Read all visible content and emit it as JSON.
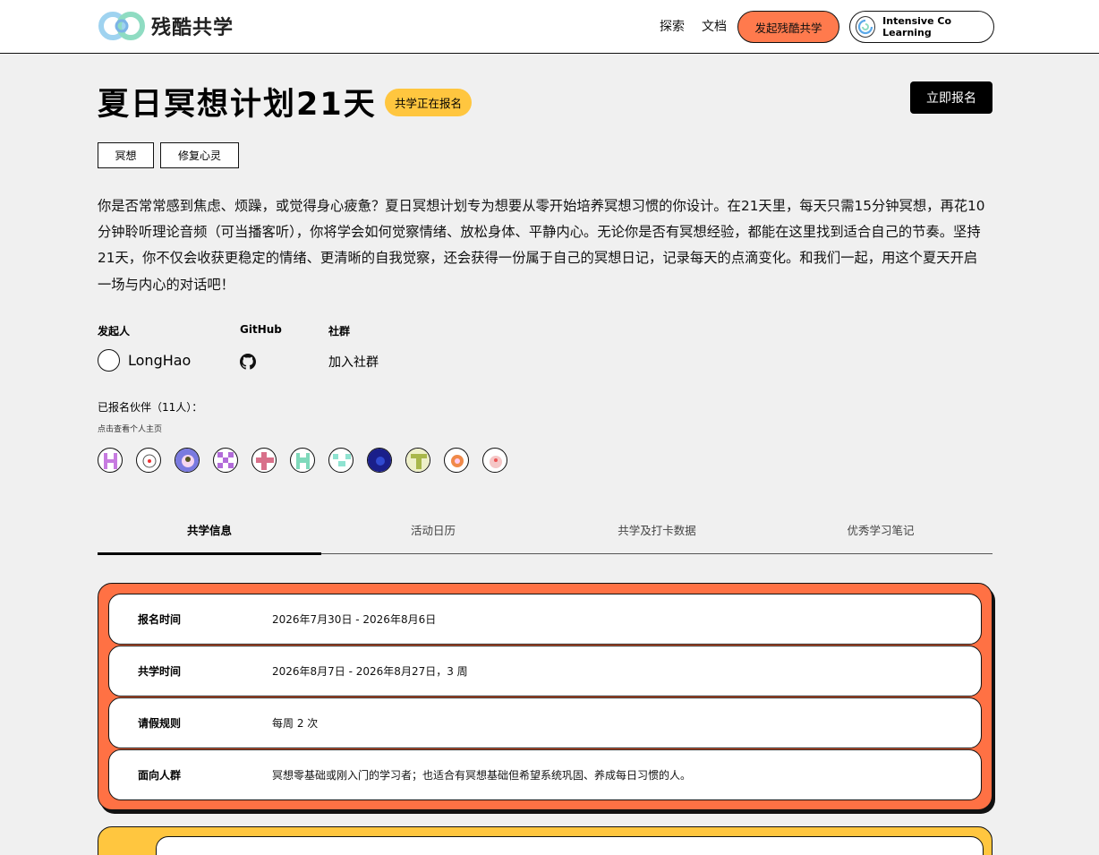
{
  "header": {
    "logo_text": "残酷共学",
    "nav": {
      "explore": "探索",
      "docs": "文档"
    },
    "start_button": "发起残酷共学",
    "icl_button": "Intensive Co Learning"
  },
  "program": {
    "title": "夏日冥想计划21天",
    "status": "共学正在报名",
    "signup_button": "立即报名",
    "tags": [
      "冥想",
      "修复心灵"
    ],
    "description": "你是否常常感到焦虑、烦躁，或觉得身心疲惫？夏日冥想计划专为想要从零开始培养冥想习惯的你设计。在21天里，每天只需15分钟冥想，再花10分钟聆听理论音频（可当播客听），你将学会如何觉察情绪、放松身体、平静内心。无论你是否有冥想经验，都能在这里找到适合自己的节奏。坚持21天，你不仅会收获更稳定的情绪、更清晰的自我觉察，还会获得一份属于自己的冥想日记，记录每天的点滴变化。和我们一起，用这个夏天开启一场与内心的对话吧！"
  },
  "meta": {
    "initiator_label": "发起人",
    "initiator_name": "LongHao",
    "github_label": "GitHub",
    "community_label": "社群",
    "community_link": "加入社群"
  },
  "partners": {
    "label": "已报名伙伴（11人）：",
    "hint": "点击查看个人主页",
    "members": [
      {
        "name": "member-1",
        "color": "#c77be0"
      },
      {
        "name": "member-2",
        "color": "#ffffff"
      },
      {
        "name": "member-3",
        "color": "#7a7ae0"
      },
      {
        "name": "member-4",
        "color": "#b26cd9"
      },
      {
        "name": "member-5",
        "color": "#d8708a"
      },
      {
        "name": "member-6",
        "color": "#7fd9bb"
      },
      {
        "name": "member-7",
        "color": "#8fe3d1"
      },
      {
        "name": "member-8",
        "color": "#1a1f8a"
      },
      {
        "name": "member-9",
        "color": "#a9b84a"
      },
      {
        "name": "member-10",
        "color": "#f08a4a"
      },
      {
        "name": "member-11",
        "color": "#f5c7c7"
      }
    ]
  },
  "tabs": [
    {
      "label": "共学信息",
      "active": true
    },
    {
      "label": "活动日历",
      "active": false
    },
    {
      "label": "共学及打卡数据",
      "active": false
    },
    {
      "label": "优秀学习笔记",
      "active": false
    }
  ],
  "info": [
    {
      "key": "报名时间",
      "value": "2026年7月30日 - 2026年8月6日"
    },
    {
      "key": "共学时间",
      "value": "2026年8月7日 - 2026年8月27日，3 周"
    },
    {
      "key": "请假规则",
      "value": "每周 2 次"
    },
    {
      "key": "面向人群",
      "value": "冥想零基础或刚入门的学习者；也适合有冥想基础但希望系统巩固、养成每日习惯的人。"
    }
  ],
  "colors": {
    "accent_orange": "#ff7144",
    "accent_yellow": "#ffc63f",
    "primary_black": "#000000"
  }
}
